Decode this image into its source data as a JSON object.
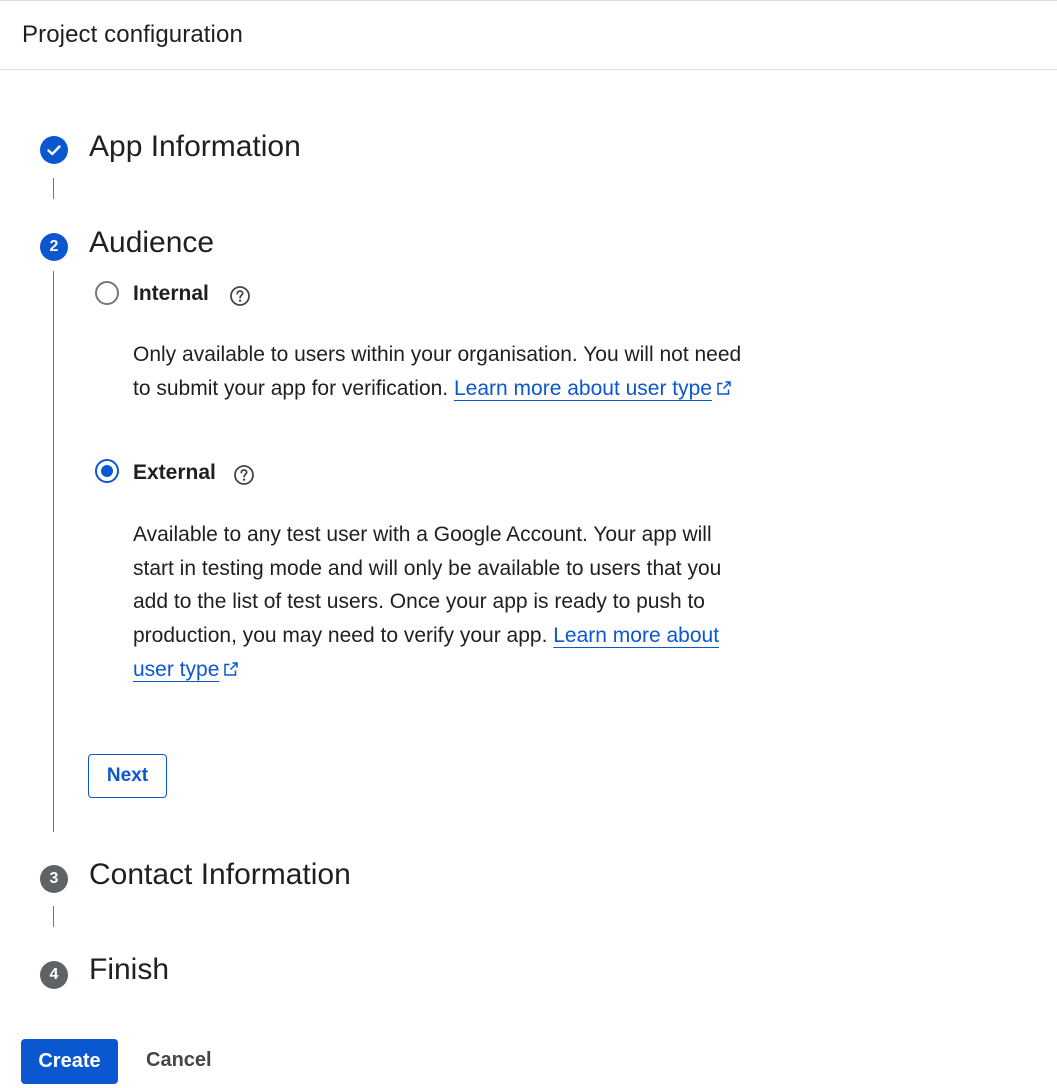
{
  "header": {
    "title": "Project configuration"
  },
  "steps": [
    {
      "number": "1",
      "title": "App Information",
      "state": "completed",
      "icon": "check-icon"
    },
    {
      "number": "2",
      "title": "Audience",
      "state": "active"
    },
    {
      "number": "3",
      "title": "Contact Information",
      "state": "pending"
    },
    {
      "number": "4",
      "title": "Finish",
      "state": "pending"
    }
  ],
  "audience": {
    "options": [
      {
        "label": "Internal",
        "selected": false,
        "description": "Only available to users within your organisation. You will not need to submit your app for verification.",
        "link_text": "Learn more about user type"
      },
      {
        "label": "External",
        "selected": true,
        "description": "Available to any test user with a Google Account. Your app will start in testing mode and will only be available to users that you add to the list of test users. Once your app is ready to push to production, you may need to verify your app.",
        "link_text": "Learn more about user type"
      }
    ],
    "next_label": "Next"
  },
  "footer": {
    "create_label": "Create",
    "cancel_label": "Cancel"
  },
  "colors": {
    "accent": "#0b57d0",
    "pending_step": "#5f6368",
    "divider": "#dadce0"
  }
}
